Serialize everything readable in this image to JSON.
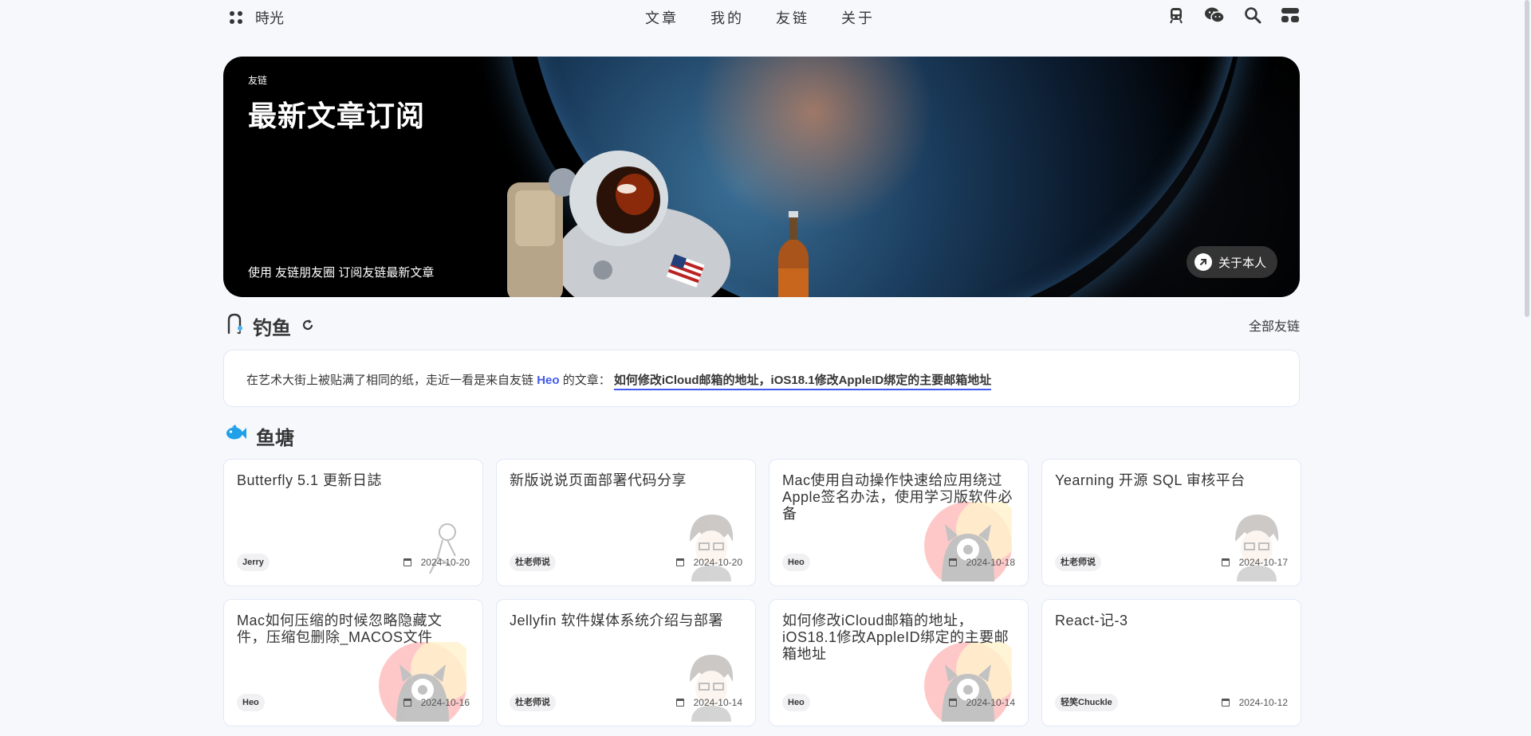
{
  "nav": {
    "brand": "時光",
    "menu": [
      "文章",
      "我的",
      "友链",
      "关于"
    ],
    "icons": [
      "train-icon",
      "wechat-icon",
      "search-icon",
      "console-icon"
    ]
  },
  "hero": {
    "tag": "友链",
    "title": "最新文章订阅",
    "description": "使用 友链朋友圈 订阅友链最新文章",
    "about_button": "关于本人"
  },
  "fishing": {
    "title": "钓鱼",
    "all_friends": "全部友链",
    "text_prefix": "在艺术大街上被贴满了相同的纸，走近一看是来自友链",
    "author": "Heo",
    "text_mid": "的文章：",
    "article_link": "如何修改iCloud邮箱的地址，iOS18.1修改AppleID绑定的主要邮箱地址"
  },
  "pond": {
    "title": "鱼塘",
    "cards": [
      {
        "title": "Butterfly 5.1 更新日誌",
        "author": "Jerry",
        "date": "2024-10-20",
        "avatar": "sketch"
      },
      {
        "title": "新版说说页面部署代码分享",
        "author": "杜老师说",
        "date": "2024-10-20",
        "avatar": "anime"
      },
      {
        "title": "Mac使用自动操作快速给应用绕过Apple签名办法，使用学习版软件必备",
        "author": "Heo",
        "date": "2024-10-18",
        "avatar": "heo"
      },
      {
        "title": "Yearning 开源 SQL 审核平台",
        "author": "杜老师说",
        "date": "2024-10-17",
        "avatar": "anime"
      },
      {
        "title": "Mac如何压缩的时候忽略隐藏文件，压缩包删除_MACOS文件",
        "author": "Heo",
        "date": "2024-10-16",
        "avatar": "heo"
      },
      {
        "title": "Jellyfin 软件媒体系统介绍与部署",
        "author": "杜老师说",
        "date": "2024-10-14",
        "avatar": "anime"
      },
      {
        "title": "如何修改iCloud邮箱的地址，iOS18.1修改AppleID绑定的主要邮箱地址",
        "author": "Heo",
        "date": "2024-10-14",
        "avatar": "heo"
      },
      {
        "title": "React-记-3",
        "author": "轻笑Chuckle",
        "date": "2024-10-12",
        "avatar": "none"
      }
    ]
  },
  "colors": {
    "accent": "#425aef",
    "text": "#363636",
    "page_bg": "#f6f8fc",
    "card_border": "#e3e8f7"
  }
}
